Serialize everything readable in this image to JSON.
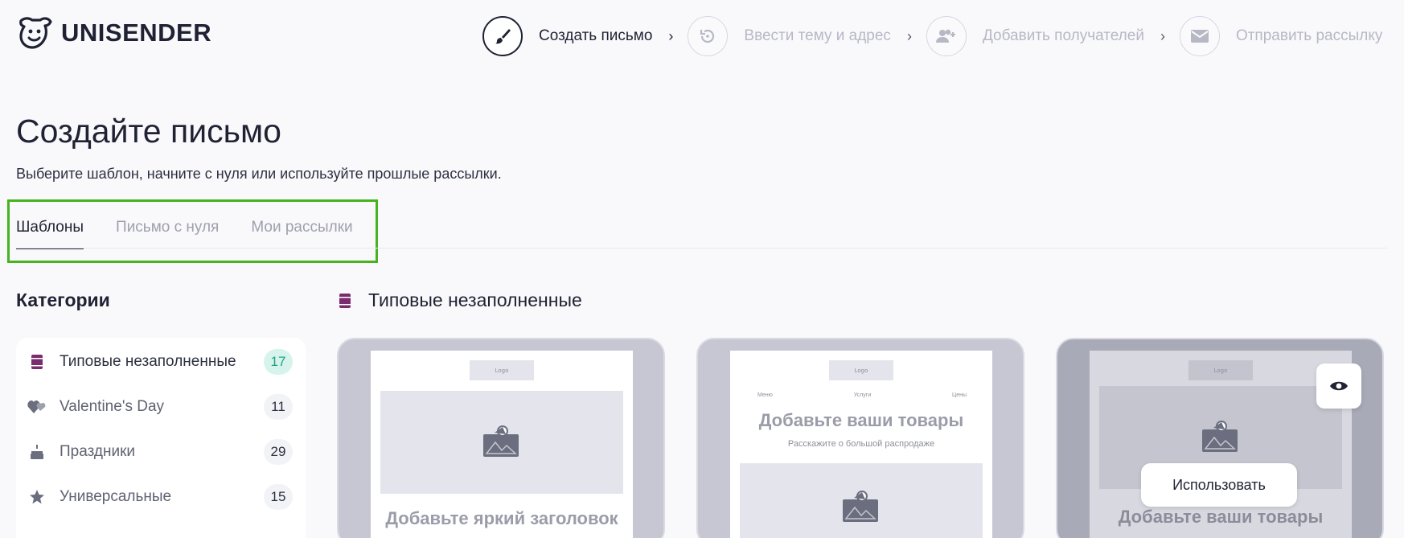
{
  "header": {
    "brand": "UNISENDER",
    "steps": [
      {
        "label": "Создать письмо",
        "icon": "brush-icon",
        "active": true
      },
      {
        "label": "Ввести тему и адрес",
        "icon": "history-icon",
        "active": false
      },
      {
        "label": "Добавить получателей",
        "icon": "add-users-icon",
        "active": false
      },
      {
        "label": "Отправить рассылку",
        "icon": "envelope-icon",
        "active": false
      }
    ]
  },
  "page": {
    "title": "Создайте письмо",
    "subtitle": "Выберите шаблон, начните с нуля или используйте прошлые рассылки."
  },
  "tabs": [
    {
      "label": "Шаблоны",
      "active": true
    },
    {
      "label": "Письмо с нуля",
      "active": false
    },
    {
      "label": "Мои рассылки",
      "active": false
    }
  ],
  "categories": {
    "title": "Категории",
    "items": [
      {
        "label": "Типовые незаполненные",
        "count": "17",
        "icon": "template-icon",
        "selected": true
      },
      {
        "label": "Valentine's Day",
        "count": "11",
        "icon": "hearts-icon",
        "selected": false
      },
      {
        "label": "Праздники",
        "count": "29",
        "icon": "cake-icon",
        "selected": false
      },
      {
        "label": "Универсальные",
        "count": "15",
        "icon": "star-icon",
        "selected": false
      }
    ]
  },
  "section": {
    "title": "Типовые незаполненные",
    "icon": "template-icon"
  },
  "cards": [
    {
      "logo": "Logo",
      "heading": "Добавьте яркий заголовок"
    },
    {
      "logo": "Logo",
      "nav": [
        "Меню",
        "Услуги",
        "Цены"
      ],
      "heading": "Добавьте ваши товары",
      "sub": "Расскажите о большой распродаже"
    },
    {
      "logo": "Logo",
      "heading": "Добавьте ваши товары",
      "use_label": "Использовать",
      "preview_icon": "eye-icon"
    }
  ],
  "colors": {
    "accent_green": "#47b31f",
    "template_icon": "#7a2d6e",
    "count_highlight_bg": "#d7f4ec",
    "count_highlight_text": "#21a383"
  }
}
